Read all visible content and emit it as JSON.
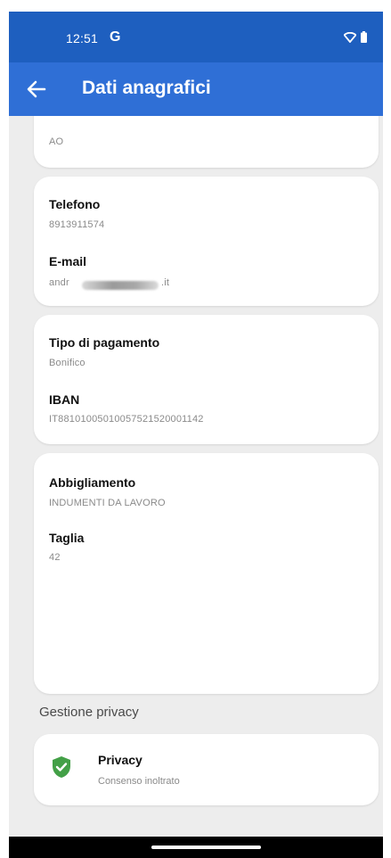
{
  "status_bar": {
    "time": "12:51",
    "google_badge": "G"
  },
  "app_bar": {
    "title": "Dati anagrafici"
  },
  "cards": {
    "top_partial": {
      "value": "AO"
    },
    "contact": {
      "phone_label": "Telefono",
      "phone_value": "8913911574",
      "email_label": "E-mail",
      "email_prefix": "andr",
      "email_suffix": ".it"
    },
    "payment": {
      "type_label": "Tipo di pagamento",
      "type_value": "Bonifico",
      "iban_label": "IBAN",
      "iban_value": "IT88101005010057521520001142"
    },
    "clothing": {
      "clothing_label": "Abbigliamento",
      "clothing_value": "INDUMENTI DA LAVORO",
      "size_label": "Taglia",
      "size_value": "42"
    }
  },
  "privacy_section": {
    "title": "Gestione privacy",
    "item_title": "Privacy",
    "item_subtitle": "Consenso inoltrato"
  },
  "colors": {
    "status_bar": "#1e5fbf",
    "app_bar": "#2f6fd6",
    "background": "#ededed",
    "card": "#ffffff",
    "shield": "#43a047"
  }
}
